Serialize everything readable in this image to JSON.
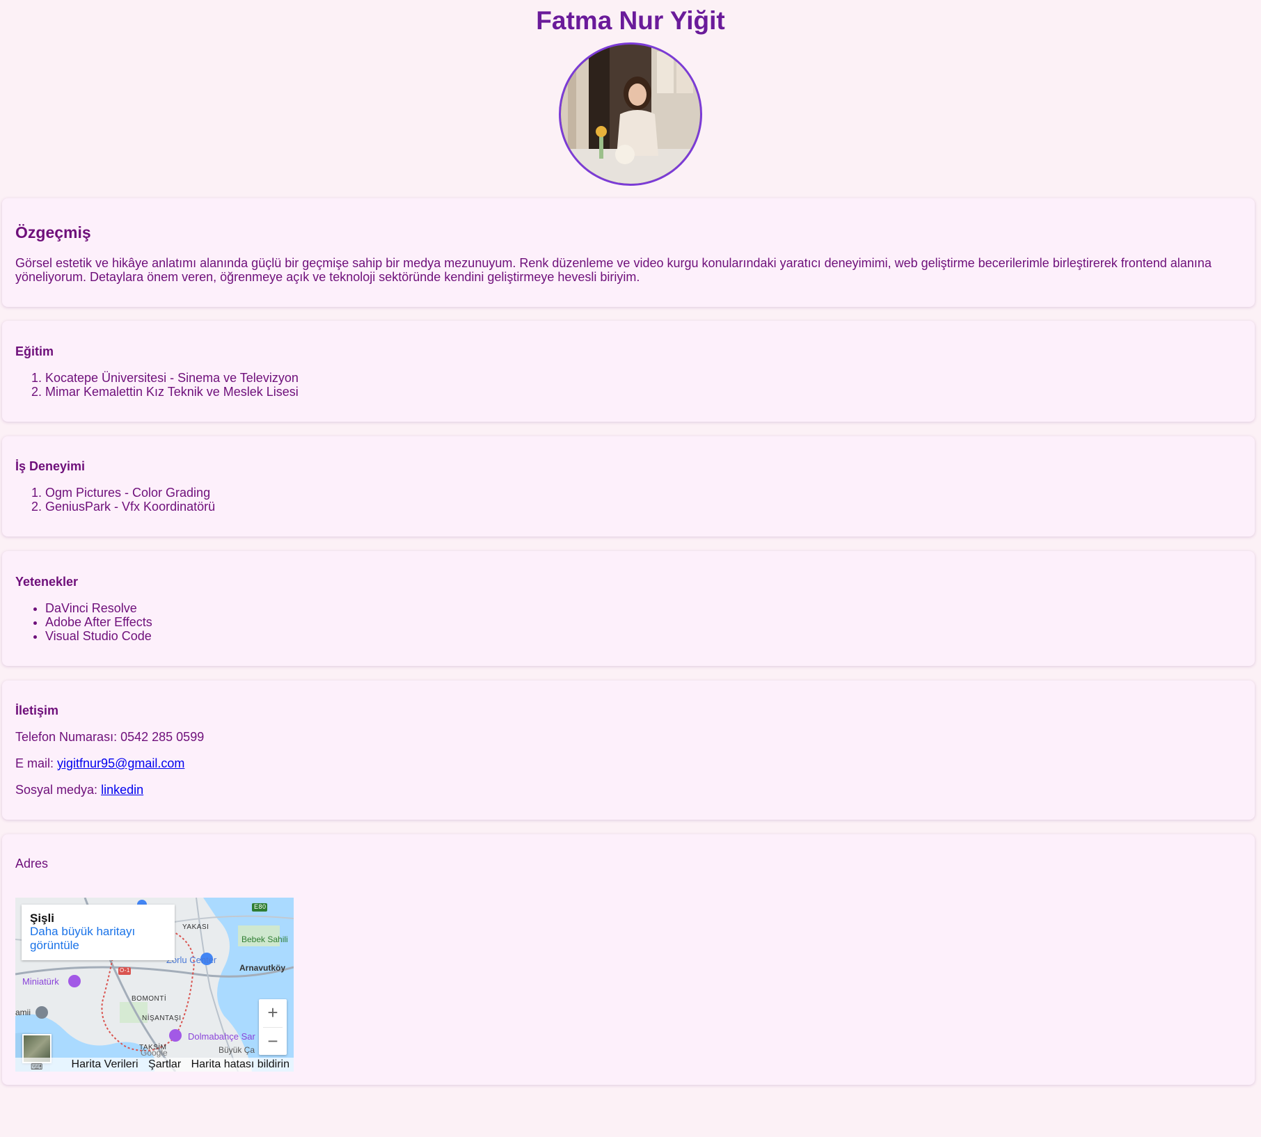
{
  "header": {
    "name": "Fatma Nur Yiğit"
  },
  "about": {
    "title": "Özgeçmiş",
    "text": "Görsel estetik ve hikâye anlatımı alanında güçlü bir geçmişe sahip bir medya mezunuyum. Renk düzenleme ve video kurgu konularındaki yaratıcı deneyimimi, web geliştirme becerilerimle birleştirerek frontend alanına yöneliyorum. Detaylara önem veren, öğrenmeye açık ve teknoloji sektöründe kendini geliştirmeye hevesli biriyim."
  },
  "education": {
    "title": "Eğitim",
    "items": [
      "Kocatepe Üniversitesi - Sinema ve Televizyon",
      "Mimar Kemalettin Kız Teknik ve Meslek Lisesi"
    ]
  },
  "experience": {
    "title": "İş Deneyimi",
    "items": [
      "Ogm Pictures - Color Grading",
      "GeniusPark - Vfx Koordinatörü"
    ]
  },
  "skills": {
    "title": "Yetenekler",
    "items": [
      "DaVinci Resolve",
      "Adobe After Effects",
      "Visual Studio Code"
    ]
  },
  "contact": {
    "title": "İletişim",
    "phone_label": "Telefon Numarası:",
    "phone": "0542 285 0599",
    "email_label": "E mail:",
    "email": "yigitfnur95@gmail.com",
    "social_label": "Sosyal medya:",
    "social_link": "linkedin"
  },
  "address": {
    "title": "Adres",
    "map": {
      "place": "Şişli",
      "view_larger": "Daha büyük haritayı görüntüle",
      "zoom_in": "+",
      "zoom_out": "−",
      "footer": {
        "data": "Harita Verileri",
        "terms": "Şartlar",
        "report": "Harita hatası bildirin"
      },
      "labels": {
        "yakasi": "YAKASI",
        "bebek": "Bebek Sahili",
        "zorlu": "Zorlu Center",
        "arnavutkoy": "Arnavutköy",
        "miniaturk": "Miniatürk",
        "bomonti": "BOMONTİ",
        "camii": "amii",
        "nisantasi": "NİŞANTAŞI",
        "dolmabahce": "Dolmabahçe Sar",
        "taksim": "TAKSİM",
        "google": "Google",
        "buyukca": "Büyük Ça",
        "e80": "E80",
        "o1": "O-1"
      }
    }
  },
  "colors": {
    "background": "#fcf1f6",
    "card": "#fdf0fb",
    "heading": "#6a1b9a",
    "text": "#6e0f7a",
    "link": "#0000ee",
    "avatar_border": "#7b3bd6"
  }
}
